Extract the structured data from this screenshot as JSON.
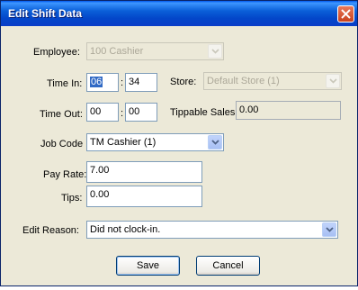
{
  "window": {
    "title": "Edit Shift Data"
  },
  "form": {
    "employee": {
      "label": "Employee:",
      "value": "100  Cashier"
    },
    "time_in": {
      "label": "Time In:",
      "hour": "06",
      "minute": "34",
      "separator": ":"
    },
    "store": {
      "label": "Store:",
      "value": "Default Store (1)"
    },
    "time_out": {
      "label": "Time Out:",
      "hour": "00",
      "minute": "00",
      "separator": ":"
    },
    "tippable_sales": {
      "label": "Tippable Sales:",
      "value": "0.00"
    },
    "job_code": {
      "label": "Job Code",
      "value": "TM Cashier (1)"
    },
    "pay_rate": {
      "label": "Pay Rate:",
      "value": "7.00"
    },
    "tips": {
      "label": "Tips:",
      "value": "0.00"
    },
    "edit_reason": {
      "label": "Edit Reason:",
      "value": "Did not clock-in."
    }
  },
  "buttons": {
    "save": "Save",
    "cancel": "Cancel"
  }
}
